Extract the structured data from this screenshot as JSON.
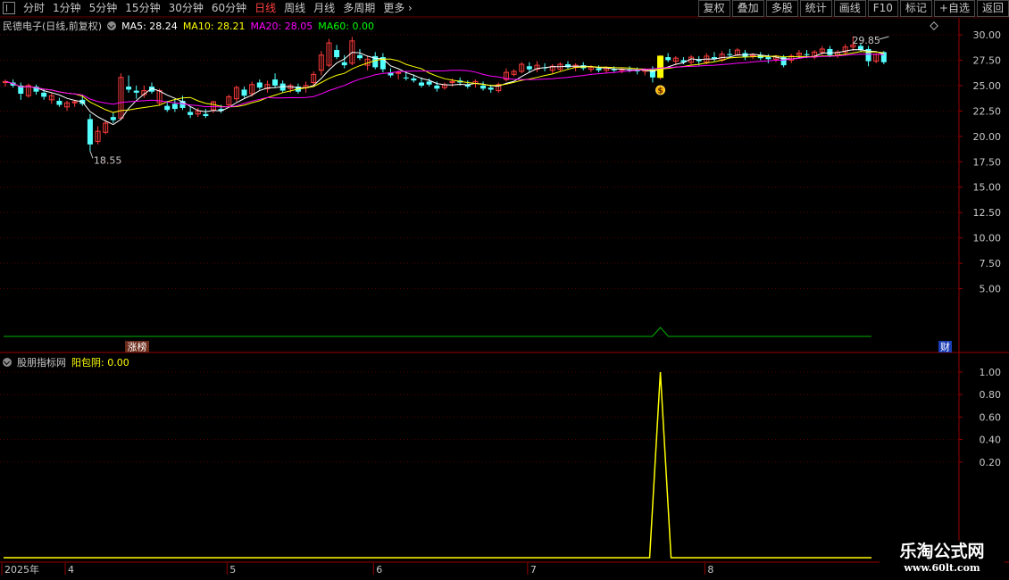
{
  "toolbar": {
    "periods": [
      "分时",
      "1分钟",
      "5分钟",
      "15分钟",
      "30分钟",
      "60分钟",
      "日线",
      "周线",
      "月线",
      "多周期",
      "更多 ›"
    ],
    "active_period": "日线",
    "tools": [
      "复权",
      "叠加",
      "多股",
      "统计",
      "画线",
      "F10",
      "标记",
      "+自选",
      "返回"
    ]
  },
  "main_legend": {
    "title": "民德电子(日线,前复权)",
    "ma5": "MA5: 28.24",
    "ma10": "MA10: 28.21",
    "ma20": "MA20: 28.05",
    "ma60": "MA60: 0.00"
  },
  "sub_legend": {
    "title": "股朋指标网",
    "value": "阳包阴: 0.00"
  },
  "markers": {
    "low_label": "18.55",
    "high_label": "29.85",
    "zhangbang": "涨榜",
    "cai": "财",
    "dollar": "$"
  },
  "colors": {
    "up": "#ff3c3c",
    "down": "#54ffff",
    "ma5": "#ffffff",
    "ma10": "#ffff00",
    "ma20": "#ff00ff",
    "signal": "#ffff00",
    "axis": "#990000"
  },
  "chart_data": [
    {
      "type": "candlestick",
      "title": "民德电子(日线,前复权)",
      "ylim": [
        3,
        31
      ],
      "y_ticks": [
        30,
        27.5,
        25,
        22.5,
        20,
        17.5,
        15,
        12.5,
        10,
        7.5,
        5
      ],
      "y_tick_labels": [
        "30.00",
        "27.50",
        "25.00",
        "22.50",
        "20.00",
        "17.50",
        "15.00",
        "12.50",
        "10.00",
        "7.50",
        "5.00"
      ],
      "x_labels": [
        {
          "index": 0,
          "label": "2025年"
        },
        {
          "index": 8,
          "label": "4"
        },
        {
          "index": 29,
          "label": "5"
        },
        {
          "index": 48,
          "label": "6"
        },
        {
          "index": 68,
          "label": "7"
        },
        {
          "index": 91,
          "label": "8"
        }
      ],
      "highlight_index": 85,
      "ohlc": [
        [
          25.3,
          25.6,
          24.9,
          25.4
        ],
        [
          25.3,
          25.6,
          24.8,
          25.0
        ],
        [
          25.0,
          25.3,
          23.6,
          24.2
        ],
        [
          24.0,
          25.2,
          23.8,
          25.0
        ],
        [
          24.9,
          25.1,
          24.1,
          24.4
        ],
        [
          24.3,
          24.7,
          23.6,
          23.9
        ],
        [
          23.6,
          24.3,
          23.2,
          24.0
        ],
        [
          23.5,
          23.8,
          22.9,
          23.1
        ],
        [
          22.9,
          23.5,
          22.5,
          23.3
        ],
        [
          23.3,
          23.6,
          22.9,
          23.4
        ],
        [
          23.6,
          24.1,
          23.0,
          23.2
        ],
        [
          21.7,
          22.2,
          18.55,
          19.2
        ],
        [
          19.5,
          21.0,
          19.2,
          20.5
        ],
        [
          20.4,
          21.6,
          20.2,
          21.3
        ],
        [
          21.9,
          22.4,
          21.3,
          21.6
        ],
        [
          21.8,
          26.2,
          21.6,
          25.8
        ],
        [
          24.9,
          26.0,
          24.3,
          24.6
        ],
        [
          24.5,
          25.0,
          23.7,
          24.3
        ],
        [
          24.1,
          25.0,
          23.8,
          24.5
        ],
        [
          24.9,
          25.3,
          24.2,
          24.4
        ],
        [
          23.3,
          24.7,
          23.0,
          24.5
        ],
        [
          23.0,
          23.5,
          22.4,
          22.6
        ],
        [
          23.2,
          23.6,
          22.4,
          22.7
        ],
        [
          23.5,
          24.0,
          22.6,
          22.8
        ],
        [
          22.4,
          22.9,
          21.8,
          22.1
        ],
        [
          22.2,
          22.8,
          21.9,
          22.5
        ],
        [
          22.2,
          22.7,
          21.8,
          22.0
        ],
        [
          22.6,
          23.5,
          22.3,
          23.4
        ],
        [
          22.7,
          23.1,
          22.3,
          22.5
        ],
        [
          23.1,
          24.1,
          22.9,
          23.9
        ],
        [
          23.7,
          25.0,
          23.4,
          24.8
        ],
        [
          24.6,
          24.9,
          23.8,
          24.0
        ],
        [
          24.2,
          25.4,
          23.9,
          25.1
        ],
        [
          25.3,
          25.6,
          24.6,
          24.8
        ],
        [
          24.7,
          25.5,
          24.3,
          25.1
        ],
        [
          25.6,
          26.2,
          24.8,
          25.0
        ],
        [
          25.2,
          25.5,
          24.3,
          24.5
        ],
        [
          24.7,
          25.2,
          24.3,
          25.0
        ],
        [
          24.9,
          25.2,
          24.2,
          24.4
        ],
        [
          24.8,
          25.4,
          24.3,
          25.0
        ],
        [
          25.3,
          26.4,
          24.9,
          26.1
        ],
        [
          26.5,
          28.4,
          26.0,
          28.0
        ],
        [
          27.0,
          29.6,
          26.8,
          29.2
        ],
        [
          28.5,
          29.0,
          27.6,
          27.8
        ],
        [
          27.3,
          28.0,
          26.7,
          27.0
        ],
        [
          27.2,
          29.8,
          27.0,
          29.4
        ],
        [
          28.0,
          28.6,
          27.5,
          27.7
        ],
        [
          27.0,
          27.9,
          26.5,
          27.6
        ],
        [
          27.9,
          28.3,
          26.6,
          26.8
        ],
        [
          27.8,
          28.2,
          26.3,
          26.6
        ],
        [
          26.3,
          26.7,
          25.8,
          26.0
        ],
        [
          26.2,
          26.5,
          25.6,
          26.3
        ],
        [
          25.8,
          26.4,
          25.5,
          25.7
        ],
        [
          25.7,
          26.1,
          25.3,
          25.5
        ],
        [
          25.3,
          25.8,
          24.8,
          25.0
        ],
        [
          25.4,
          25.7,
          24.9,
          25.1
        ],
        [
          25.0,
          25.4,
          24.4,
          24.7
        ],
        [
          24.8,
          25.3,
          24.6,
          25.1
        ],
        [
          25.3,
          25.7,
          24.9,
          25.4
        ],
        [
          25.5,
          25.8,
          25.0,
          25.3
        ],
        [
          25.1,
          25.5,
          24.7,
          24.9
        ],
        [
          25.2,
          25.6,
          24.8,
          25.4
        ],
        [
          25.0,
          25.4,
          24.5,
          24.7
        ],
        [
          24.8,
          25.1,
          24.3,
          24.6
        ],
        [
          24.5,
          25.3,
          24.3,
          25.1
        ],
        [
          25.6,
          26.7,
          25.4,
          26.3
        ],
        [
          26.1,
          26.6,
          25.9,
          26.4
        ],
        [
          26.4,
          27.3,
          26.2,
          27.1
        ],
        [
          26.9,
          27.3,
          26.3,
          26.6
        ],
        [
          26.6,
          27.4,
          26.3,
          27.0
        ],
        [
          26.8,
          27.2,
          26.4,
          26.7
        ],
        [
          26.5,
          27.1,
          26.2,
          26.9
        ],
        [
          26.6,
          27.3,
          26.4,
          27.1
        ],
        [
          27.1,
          27.4,
          26.6,
          26.8
        ],
        [
          26.8,
          27.2,
          26.4,
          27.0
        ],
        [
          27.0,
          27.3,
          26.5,
          26.7
        ],
        [
          26.6,
          27.0,
          26.3,
          26.8
        ],
        [
          26.7,
          27.0,
          26.3,
          26.5
        ],
        [
          26.5,
          26.9,
          26.2,
          26.7
        ],
        [
          26.6,
          26.9,
          26.3,
          26.5
        ],
        [
          26.5,
          26.8,
          26.2,
          26.6
        ],
        [
          26.6,
          26.9,
          26.3,
          26.5
        ],
        [
          26.5,
          26.8,
          26.1,
          26.4
        ],
        [
          26.4,
          26.7,
          26.0,
          26.6
        ],
        [
          26.6,
          26.9,
          25.3,
          25.8
        ],
        [
          25.8,
          28.0,
          25.6,
          27.9
        ],
        [
          27.8,
          28.2,
          27.3,
          27.5
        ],
        [
          27.4,
          27.9,
          27.0,
          27.7
        ],
        [
          27.5,
          27.8,
          27.1,
          27.3
        ],
        [
          27.3,
          28.0,
          27.0,
          27.8
        ],
        [
          27.6,
          27.9,
          27.0,
          27.4
        ],
        [
          27.3,
          28.2,
          27.1,
          27.9
        ],
        [
          27.8,
          28.3,
          27.4,
          27.6
        ],
        [
          27.5,
          28.4,
          27.3,
          28.1
        ],
        [
          28.1,
          28.6,
          27.8,
          28.0
        ],
        [
          28.0,
          28.7,
          27.9,
          28.5
        ],
        [
          28.2,
          28.5,
          27.5,
          27.8
        ],
        [
          27.9,
          28.2,
          27.6,
          28.0
        ],
        [
          28.0,
          28.3,
          27.5,
          27.7
        ],
        [
          27.8,
          28.1,
          27.2,
          27.6
        ],
        [
          27.6,
          28.0,
          27.3,
          27.9
        ],
        [
          27.8,
          28.0,
          26.8,
          27.0
        ],
        [
          27.5,
          28.1,
          27.2,
          27.9
        ],
        [
          28.0,
          28.5,
          27.7,
          28.2
        ],
        [
          28.1,
          28.5,
          27.7,
          28.0
        ],
        [
          27.8,
          28.5,
          27.6,
          28.3
        ],
        [
          28.3,
          28.9,
          28.0,
          28.6
        ],
        [
          28.6,
          28.9,
          27.8,
          28.0
        ],
        [
          28.0,
          28.5,
          27.7,
          28.3
        ],
        [
          28.3,
          29.1,
          28.0,
          28.8
        ],
        [
          28.8,
          29.85,
          28.4,
          29.0
        ],
        [
          28.9,
          29.2,
          28.3,
          28.5
        ],
        [
          28.6,
          28.9,
          26.9,
          27.4
        ],
        [
          27.4,
          28.2,
          27.2,
          28.1
        ],
        [
          28.3,
          28.4,
          27.1,
          27.3
        ]
      ]
    },
    {
      "type": "line",
      "title": "股朋指标网",
      "series": [
        {
          "name": "阳包阴",
          "values_rule": "0 everywhere except 1.00 at highlight_index",
          "peak_index": 85,
          "peak_value": 1.0,
          "last_value": 0.0
        }
      ],
      "ylim": [
        0.08,
        1.08
      ],
      "y_ticks": [
        1.0,
        0.8,
        0.6,
        0.4,
        0.2
      ],
      "y_tick_labels": [
        "1.00",
        "0.80",
        "0.60",
        "0.40",
        "0.20"
      ]
    }
  ]
}
